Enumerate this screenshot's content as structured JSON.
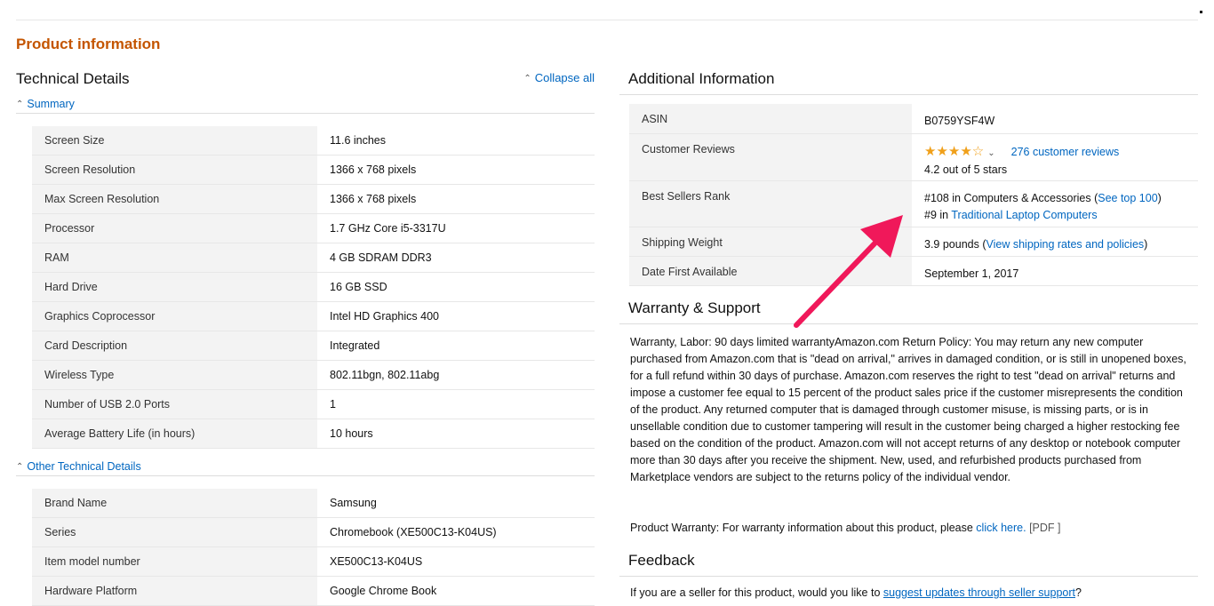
{
  "section_title": "Product information",
  "technical_details": {
    "heading": "Technical Details",
    "collapse_all": "Collapse all",
    "summary": {
      "toggle": "Summary",
      "rows": [
        {
          "label": "Screen Size",
          "value": "11.6 inches"
        },
        {
          "label": "Screen Resolution",
          "value": "1366 x 768 pixels"
        },
        {
          "label": "Max Screen Resolution",
          "value": "1366 x 768 pixels"
        },
        {
          "label": "Processor",
          "value": "1.7 GHz Core i5-3317U"
        },
        {
          "label": "RAM",
          "value": "4 GB SDRAM DDR3"
        },
        {
          "label": "Hard Drive",
          "value": "16 GB SSD"
        },
        {
          "label": "Graphics Coprocessor",
          "value": "Intel HD Graphics 400"
        },
        {
          "label": "Card Description",
          "value": "Integrated"
        },
        {
          "label": "Wireless Type",
          "value": "802.11bgn, 802.11abg"
        },
        {
          "label": "Number of USB 2.0 Ports",
          "value": "1"
        },
        {
          "label": "Average Battery Life (in hours)",
          "value": "10 hours"
        }
      ]
    },
    "other": {
      "toggle": "Other Technical Details",
      "rows": [
        {
          "label": "Brand Name",
          "value": "Samsung"
        },
        {
          "label": "Series",
          "value": "Chromebook (XE500C13-K04US)"
        },
        {
          "label": "Item model number",
          "value": "XE500C13-K04US"
        },
        {
          "label": "Hardware Platform",
          "value": "Google Chrome Book"
        }
      ]
    }
  },
  "additional_info": {
    "heading": "Additional Information",
    "asin_label": "ASIN",
    "asin_value": "B0759YSF4W",
    "reviews_label": "Customer Reviews",
    "stars_filled": "★★★★",
    "stars_empty": "☆",
    "rating_value": 4.2,
    "reviews_link": "276 customer reviews",
    "rating_text": "4.2 out of 5 stars",
    "rank_label": "Best Sellers Rank",
    "rank_1_text": "#108 in Computers & Accessories (",
    "rank_1_link": "See top 100",
    "rank_1_close": ")",
    "rank_2_text": "#9 in ",
    "rank_2_link": "Traditional Laptop Computers",
    "shipping_label": "Shipping Weight",
    "shipping_text": "3.9 pounds (",
    "shipping_link": "View shipping rates and policies",
    "shipping_close": ")",
    "date_label": "Date First Available",
    "date_value": "September 1, 2017"
  },
  "warranty": {
    "heading": "Warranty & Support",
    "text": "Warranty, Labor: 90 days limited warrantyAmazon.com Return Policy: You may return any new computer purchased from Amazon.com that is \"dead on arrival,\" arrives in damaged condition, or is still in unopened boxes, for a full refund within 30 days of purchase. Amazon.com reserves the right to test \"dead on arrival\" returns and impose a customer fee equal to 15 percent of the product sales price if the customer misrepresents the condition of the product. Any returned computer that is damaged through customer misuse, is missing parts, or is in unsellable condition due to customer tampering will result in the customer being charged a higher restocking fee based on the condition of the product. Amazon.com will not accept returns of any desktop or notebook computer more than 30 days after you receive the shipment. New, used, and refurbished products purchased from Marketplace vendors are subject to the returns policy of the individual vendor.",
    "product_warranty_text": "Product Warranty: For warranty information about this product, please ",
    "click_here": "click here.",
    "pdf": "[PDF ]"
  },
  "feedback": {
    "heading": "Feedback",
    "text": "If you are a seller for this product, would you like to ",
    "link": "suggest updates through seller support",
    "end": "?"
  },
  "colors": {
    "section_title": "#c45500",
    "link": "#0066c0",
    "star": "#f0a01a",
    "arrow": "#f0185a",
    "label_bg": "#f3f3f3"
  }
}
